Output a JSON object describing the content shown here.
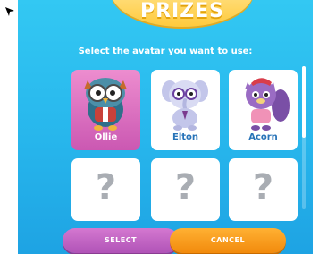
{
  "screen": {
    "title": "PRIZES",
    "instruction": "Select the avatar you want to use:"
  },
  "avatars": [
    {
      "name": "Ollie",
      "selected": true,
      "icon": "owl-avatar-icon"
    },
    {
      "name": "Elton",
      "selected": false,
      "icon": "elephant-avatar-icon"
    },
    {
      "name": "Acorn",
      "selected": false,
      "icon": "squirrel-avatar-icon"
    }
  ],
  "locked_slots": [
    {
      "symbol": "?"
    },
    {
      "symbol": "?"
    },
    {
      "symbol": "?"
    }
  ],
  "buttons": {
    "select_label": "SELECT",
    "cancel_label": "CANCEL"
  },
  "colors": {
    "background": "#27b6ec",
    "banner": "#ffca3c",
    "selected_card": "#cb58b2",
    "select_button": "#b053b7",
    "cancel_button": "#f28a0c"
  }
}
